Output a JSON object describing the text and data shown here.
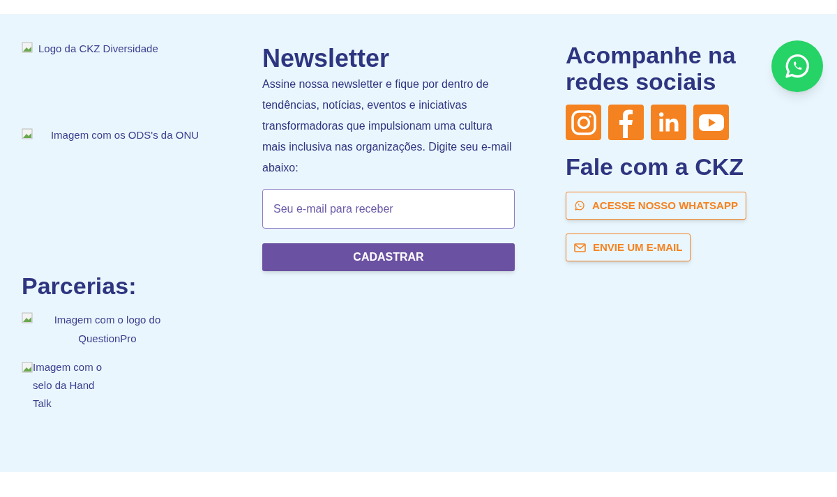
{
  "left": {
    "images": [
      {
        "kind": "inline",
        "alt": "Logo da CKZ Diversidade"
      },
      {
        "kind": "centered",
        "alt": "Imagem com os ODS's da ONU"
      }
    ],
    "partners_title": "Parcerias:",
    "partners": [
      {
        "kind": "centered",
        "alt": "Imagem com o logo do QuestionPro"
      },
      {
        "kind": "inline",
        "alt": "Imagem com o selo da Hand Talk"
      }
    ]
  },
  "newsletter": {
    "title": "Newsletter",
    "text": "Assine nossa newsletter e fique por dentro de tendências, notícias, eventos e iniciativas transformadoras que impulsionam uma cultura mais inclusiva nas organizações. Digite seu e-mail abaixo:",
    "placeholder": "Seu e-mail para receber",
    "button": "CADASTRAR"
  },
  "social": {
    "title": "Acompanhe na redes sociais",
    "icons": [
      {
        "kind": "instagram"
      },
      {
        "kind": "facebook"
      },
      {
        "kind": "linkedin"
      },
      {
        "kind": "youtube"
      }
    ]
  },
  "contact": {
    "title": "Fale com a CKZ",
    "buttons": [
      {
        "kind": "whatsapp",
        "label": "ACESSE NOSSO WHATSAPP"
      },
      {
        "kind": "email",
        "label": "ENVIE UM E-MAIL"
      }
    ]
  },
  "floating": {
    "kind": "whatsapp"
  }
}
